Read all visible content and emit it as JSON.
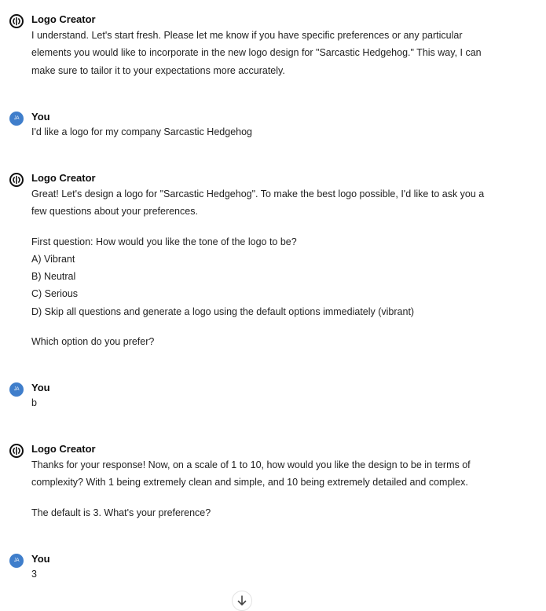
{
  "messages": [
    {
      "author": "Logo Creator",
      "avatar_icon": "logo-creator-icon",
      "lines": [
        "I understand. Let's start fresh. Please let me know if you have specific preferences or any particular",
        "elements you would like to incorporate in the new logo design for \"Sarcastic Hedgehog.\" This way, I can",
        "make sure to tailor it to your expectations more accurately."
      ]
    },
    {
      "author": "You",
      "avatar_initials": "JA",
      "lines": [
        "I'd like a logo for my company Sarcastic Hedgehog"
      ]
    },
    {
      "author": "Logo Creator",
      "avatar_icon": "logo-creator-icon",
      "intro": [
        "Great! Let's design a logo for \"Sarcastic Hedgehog\". To make the best logo possible, I'd like to ask you a",
        "few questions about your preferences."
      ],
      "question": [
        "First question: How would you like the tone of the logo to be?",
        "A) Vibrant",
        "B) Neutral",
        "C) Serious",
        "D) Skip all questions and generate a logo using the default options immediately (vibrant)"
      ],
      "closing": "Which option do you prefer?"
    },
    {
      "author": "You",
      "avatar_initials": "JA",
      "lines": [
        "b"
      ]
    },
    {
      "author": "Logo Creator",
      "avatar_icon": "logo-creator-icon",
      "intro": [
        "Thanks for your response! Now, on a scale of 1 to 10, how would you like the design to be in terms of",
        "complexity? With 1 being extremely clean and simple, and 10 being extremely detailed and complex."
      ],
      "closing": "The default is 3. What's your preference?"
    },
    {
      "author": "You",
      "avatar_initials": "JA",
      "lines": [
        "3"
      ]
    }
  ],
  "colors": {
    "user_avatar": "#3f7ecb",
    "text": "#222222"
  },
  "scroll_button_icon": "arrow-down-icon"
}
